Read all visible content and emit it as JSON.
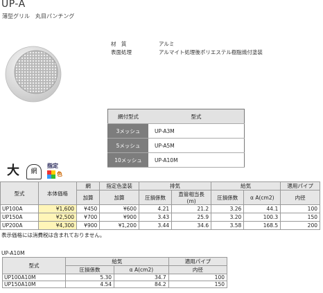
{
  "header": {
    "title": "UP-A",
    "subtitle": "薄型グリル　丸目パンチング"
  },
  "specs": [
    {
      "label": "材　質",
      "value": "アルミ"
    },
    {
      "label": "表面処理",
      "value": "アルマイト処理後ポリエステル樹脂焼付塗装"
    }
  ],
  "mesh_table": {
    "headers": [
      "網付型式",
      "型式"
    ],
    "rows": [
      {
        "label": "3メッシュ",
        "model": "UP-A3M"
      },
      {
        "label": "5メッシュ",
        "model": "UP-A5M"
      },
      {
        "label": "10メッシュ",
        "model": "UP-A10M"
      }
    ]
  },
  "icons": {
    "size": "大",
    "mesh": "網",
    "color_l1": "指定",
    "color_l2": "色"
  },
  "main_table": {
    "h1": [
      "型式",
      "本体価格",
      "網",
      "指定色塗装",
      "排気",
      "給気",
      "適用パイプ"
    ],
    "h2": [
      "加算",
      "加算",
      "圧損係数",
      "直管相当長(m)",
      "圧損係数",
      "α A(cm2)",
      "内径"
    ],
    "rows": [
      [
        "UP100A",
        "¥1,600",
        "¥450",
        "¥600",
        "4.21",
        "21.2",
        "3.26",
        "44.1",
        "100"
      ],
      [
        "UP150A",
        "¥2,500",
        "¥700",
        "¥900",
        "3.43",
        "25.9",
        "3.20",
        "100.3",
        "150"
      ],
      [
        "UP200A",
        "¥4,300",
        "¥900",
        "¥1,200",
        "3.44",
        "34.6",
        "3.58",
        "168.5",
        "200"
      ]
    ]
  },
  "note": "表示価格には消費税は含まれておりません。",
  "sub_title": "UP-A10M",
  "sub_table": {
    "h1": [
      "型式",
      "給気",
      "適用パイプ"
    ],
    "h2": [
      "圧損係数",
      "α A(cm2)",
      "内径"
    ],
    "rows": [
      [
        "UP100A10M",
        "5.30",
        "34.7",
        "100"
      ],
      [
        "UP150A10M",
        "4.54",
        "84.2",
        "150"
      ]
    ]
  }
}
